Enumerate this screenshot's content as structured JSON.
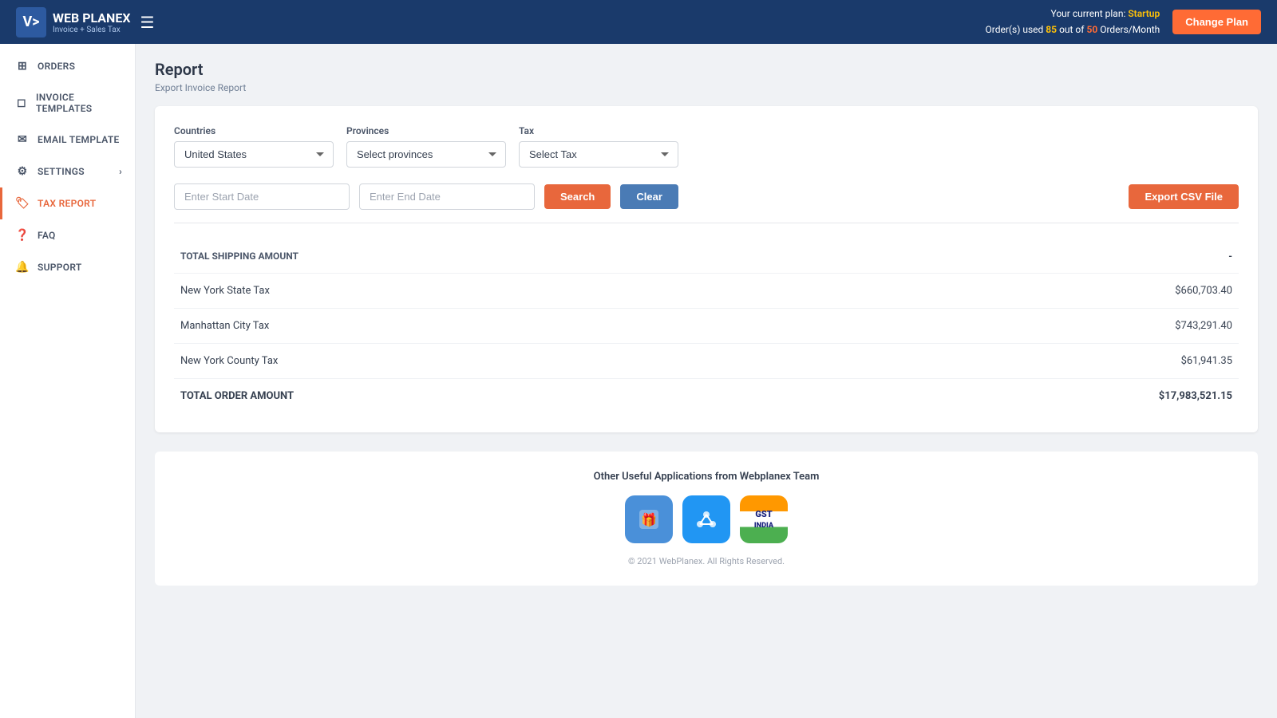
{
  "header": {
    "logo_initials": "V>",
    "brand_name": "WEB PLANEX",
    "brand_sub": "Invoice + Sales Tax",
    "hamburger_label": "☰",
    "plan_text": "Your current plan:",
    "plan_name": "Startup",
    "orders_used_label": "Order(s) used",
    "orders_used": "85",
    "orders_out_of": "out of",
    "orders_limit": "50",
    "orders_suffix": "Orders/Month",
    "change_plan_label": "Change Plan"
  },
  "sidebar": {
    "items": [
      {
        "id": "orders",
        "label": "ORDERS",
        "icon": "⊞"
      },
      {
        "id": "invoice-templates",
        "label": "INVOICE TEMPLATES",
        "icon": "□"
      },
      {
        "id": "email-template",
        "label": "EMAIL TEMPLATE",
        "icon": "✉"
      },
      {
        "id": "settings",
        "label": "SETTINGS",
        "icon": "⚙",
        "chevron": "›"
      },
      {
        "id": "tax-report",
        "label": "TAX REPORT",
        "icon": "🔖",
        "active": true
      },
      {
        "id": "faq",
        "label": "FAQ",
        "icon": "?"
      },
      {
        "id": "support",
        "label": "SUPPORT",
        "icon": "🔔"
      }
    ]
  },
  "page": {
    "title": "Report",
    "subtitle": "Export Invoice Report"
  },
  "filters": {
    "countries_label": "Countries",
    "countries_default": "United States",
    "provinces_label": "Provinces",
    "provinces_placeholder": "Select provinces",
    "tax_label": "Tax",
    "tax_placeholder": "Select Tax",
    "start_date_placeholder": "Enter Start Date",
    "end_date_placeholder": "Enter End Date",
    "search_label": "Search",
    "clear_label": "Clear",
    "export_label": "Export CSV File"
  },
  "results": [
    {
      "label": "TOTAL SHIPPING AMOUNT",
      "value": "-",
      "is_header": true
    },
    {
      "label": "New York State Tax",
      "value": "$660,703.40"
    },
    {
      "label": "Manhattan City Tax",
      "value": "$743,291.40"
    },
    {
      "label": "New York County Tax",
      "value": "$61,941.35"
    },
    {
      "label": "TOTAL ORDER AMOUNT",
      "value": "$17,983,521.15",
      "is_total": true
    }
  ],
  "footer": {
    "apps_title": "Other Useful Applications from Webplanex Team",
    "copyright": "© 2021 WebPlanex. All Rights Reserved."
  }
}
